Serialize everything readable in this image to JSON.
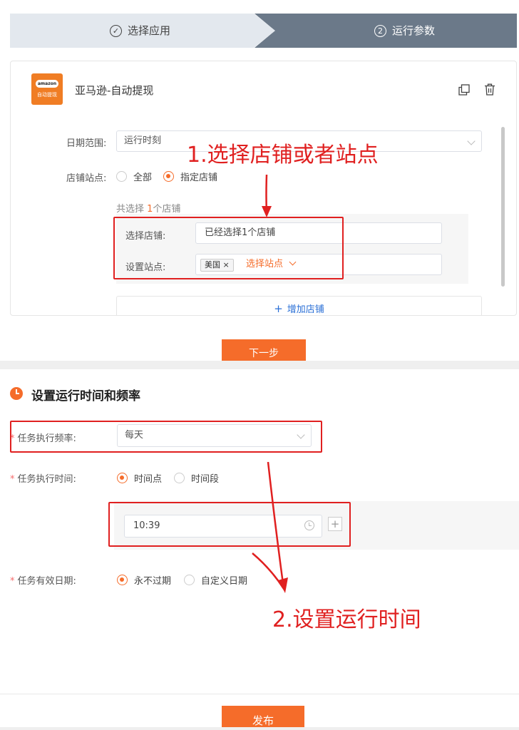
{
  "stepper": {
    "step1": {
      "number": "✓",
      "label": "选择应用"
    },
    "step2": {
      "number": "2",
      "label": "运行参数"
    }
  },
  "app": {
    "logo_top": "amazon",
    "logo_bottom": "自动提现",
    "name": "亚马逊-自动提现"
  },
  "form": {
    "date_range_label": "日期范围:",
    "date_range_value": "运行时刻",
    "store_site_label": "店铺站点:",
    "radio_all": "全部",
    "radio_specified": "指定店铺",
    "selected_prefix": "共选择 ",
    "selected_count": "1",
    "selected_suffix": "个店铺",
    "select_store_label": "选择店铺:",
    "select_store_value": "已经选择1个店铺",
    "set_site_label": "设置站点:",
    "site_tag": "美国",
    "site_tag_close": "×",
    "select_site_link": "选择站点",
    "add_store": "增加店铺"
  },
  "annotations": {
    "note1": "1.选择店铺或者站点",
    "note2": "2.设置运行时间"
  },
  "next_button": "下一步",
  "schedule": {
    "title": "设置运行时间和频率",
    "frequency_label": "任务执行频率:",
    "frequency_value": "每天",
    "time_label": "任务执行时间:",
    "radio_timepoint": "时间点",
    "radio_timerange": "时间段",
    "time_value": "10:39",
    "plus": "+",
    "validity_label": "任务有效日期:",
    "radio_never": "永不过期",
    "radio_custom": "自定义日期",
    "required_mark": "*"
  },
  "publish_button": "发布",
  "colors": {
    "accent": "#f56c2a",
    "annotation": "#e02020",
    "link": "#2a6fd6"
  }
}
